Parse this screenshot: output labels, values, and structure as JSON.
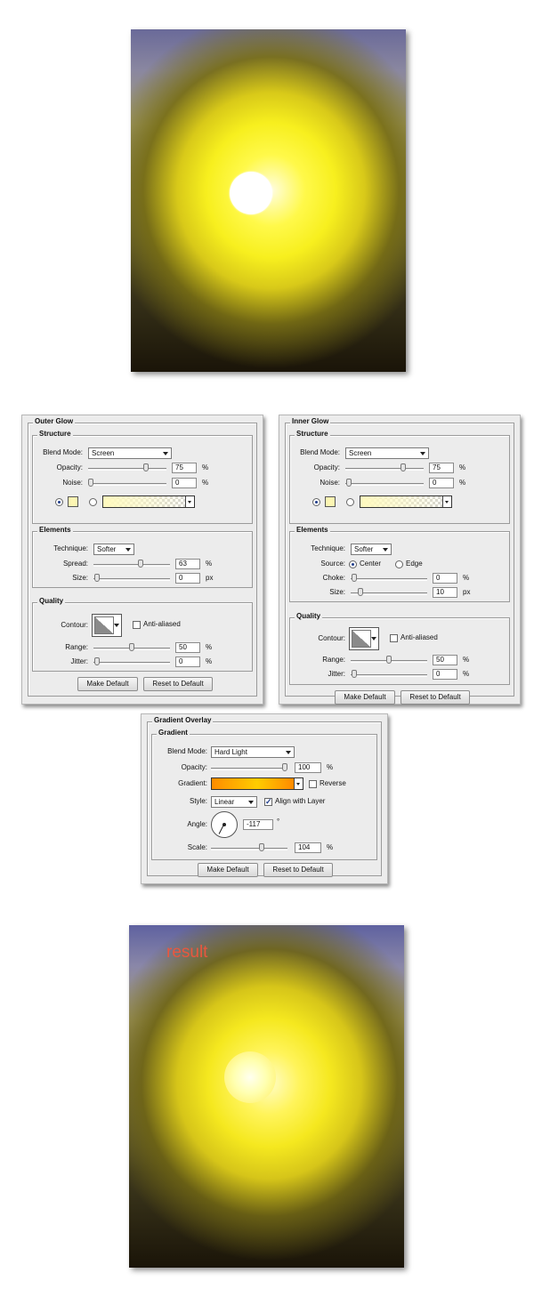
{
  "result_label": "result",
  "outer_glow": {
    "title": "Outer Glow",
    "structure": {
      "legend": "Structure",
      "blend_mode_label": "Blend Mode:",
      "blend_mode": "Screen",
      "opacity_label": "Opacity:",
      "opacity": "75",
      "opacity_percent": 0.75,
      "noise_label": "Noise:",
      "noise": "0",
      "noise_percent": 0,
      "percent": "%"
    },
    "elements": {
      "legend": "Elements",
      "technique_label": "Technique:",
      "technique": "Softer",
      "spread_label": "Spread:",
      "spread": "63",
      "spread_percent": 0.63,
      "size_label": "Size:",
      "size": "0",
      "unit_px": "px",
      "percent": "%"
    },
    "quality": {
      "legend": "Quality",
      "contour_label": "Contour:",
      "anti_aliased": "Anti-aliased",
      "range_label": "Range:",
      "range": "50",
      "range_percent": 0.5,
      "jitter_label": "Jitter:",
      "jitter": "0",
      "percent": "%"
    },
    "make_default": "Make Default",
    "reset_default": "Reset to Default",
    "glow_color": "#fdf6b3"
  },
  "inner_glow": {
    "title": "Inner Glow",
    "structure": {
      "legend": "Structure",
      "blend_mode_label": "Blend Mode:",
      "blend_mode": "Screen",
      "opacity_label": "Opacity:",
      "opacity": "75",
      "opacity_percent": 0.75,
      "noise_label": "Noise:",
      "noise": "0",
      "percent": "%"
    },
    "elements": {
      "legend": "Elements",
      "technique_label": "Technique:",
      "technique": "Softer",
      "source_label": "Source:",
      "source_center": "Center",
      "source_edge": "Edge",
      "choke_label": "Choke:",
      "choke": "0",
      "size_label": "Size:",
      "size": "10",
      "unit_px": "px",
      "percent": "%"
    },
    "quality": {
      "legend": "Quality",
      "contour_label": "Contour:",
      "anti_aliased": "Anti-aliased",
      "range_label": "Range:",
      "range": "50",
      "jitter_label": "Jitter:",
      "jitter": "0",
      "percent": "%"
    },
    "make_default": "Make Default",
    "reset_default": "Reset to Default"
  },
  "gradient_overlay": {
    "title": "Gradient Overlay",
    "legend": "Gradient",
    "blend_mode_label": "Blend Mode:",
    "blend_mode": "Hard Light",
    "opacity_label": "Opacity:",
    "opacity": "100",
    "opacity_percent": 1.0,
    "gradient_label": "Gradient:",
    "reverse": "Reverse",
    "style_label": "Style:",
    "style": "Linear",
    "align_with_layer": "Align with Layer",
    "angle_label": "Angle:",
    "angle": "-117",
    "degree": "°",
    "scale_label": "Scale:",
    "scale": "104",
    "percent": "%",
    "make_default": "Make Default",
    "reset_default": "Reset to Default",
    "gradient_colors": [
      "#ff8c00",
      "#ffcc00",
      "#ff7a00"
    ]
  }
}
